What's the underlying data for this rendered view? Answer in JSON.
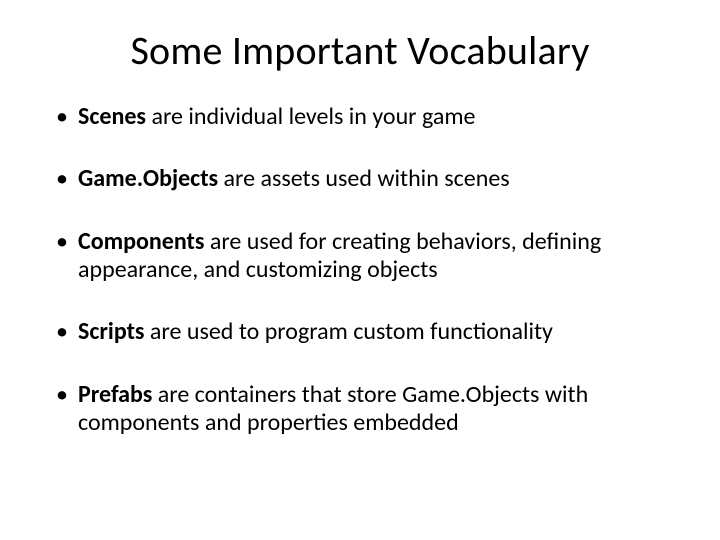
{
  "title": "Some Important Vocabulary",
  "bullets": [
    {
      "term": "Scenes",
      "rest": " are individual levels in your game"
    },
    {
      "term": "Game.Objects",
      "rest": " are assets used within scenes"
    },
    {
      "term": "Components",
      "rest": " are used for creating behaviors, defining appearance, and customizing objects"
    },
    {
      "term": "Scripts",
      "rest": " are used to program custom functionality"
    },
    {
      "term": "Prefabs",
      "rest": " are containers that store Game.Objects with components and properties embedded"
    }
  ]
}
